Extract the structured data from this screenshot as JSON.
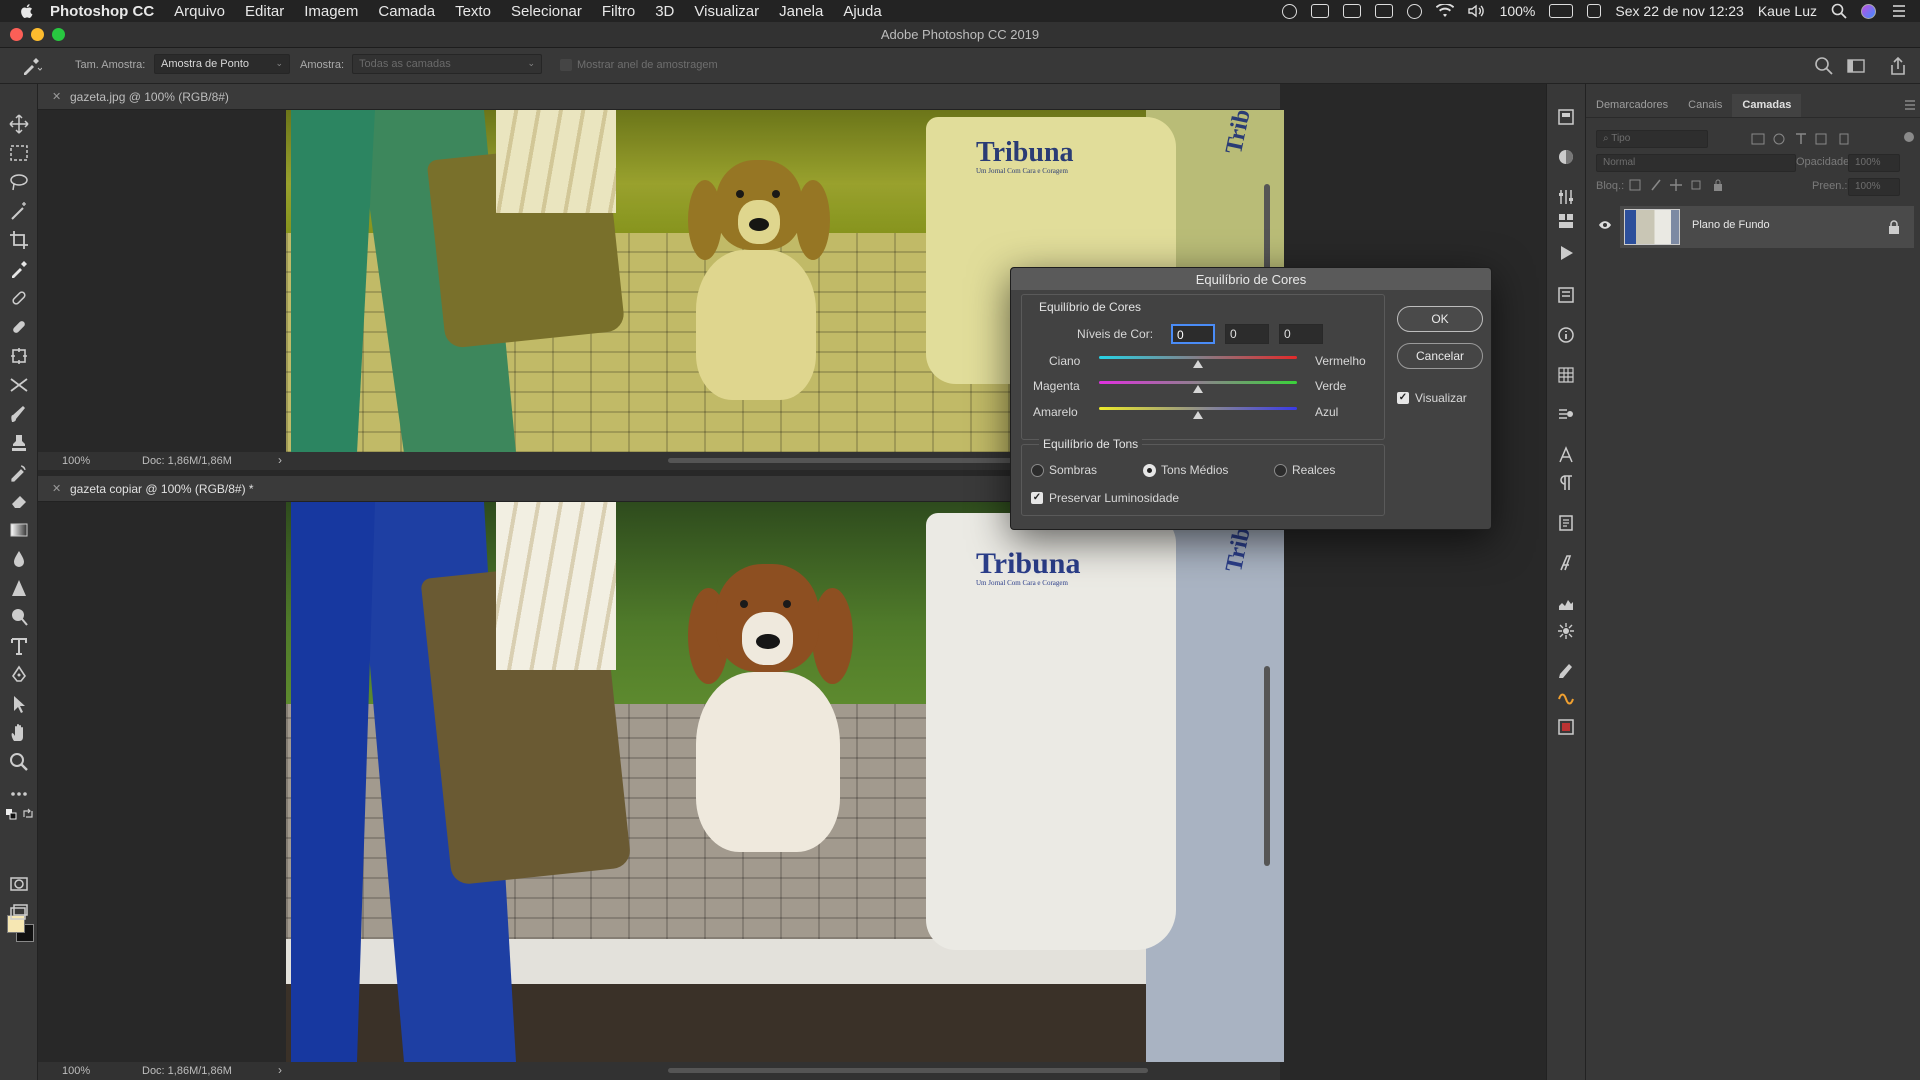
{
  "menubar": {
    "app_name": "Photoshop CC",
    "items": [
      "Arquivo",
      "Editar",
      "Imagem",
      "Camada",
      "Texto",
      "Selecionar",
      "Filtro",
      "3D",
      "Visualizar",
      "Janela",
      "Ajuda"
    ],
    "battery": "100%",
    "datetime": "Sex 22 de nov  12:23",
    "user": "Kaue Luz"
  },
  "window": {
    "title": "Adobe Photoshop CC 2019"
  },
  "options_bar": {
    "sample_size_label": "Tam. Amostra:",
    "sample_size_value": "Amostra de Ponto",
    "sample_label": "Amostra:",
    "sample_value": "Todas as camadas",
    "show_ring_label": "Mostrar anel de amostragem"
  },
  "documents": [
    {
      "tab": "gazeta.jpg @ 100% (RGB/8#)",
      "zoom": "100%",
      "doc_info": "Doc: 1,86M/1,86M"
    },
    {
      "tab": "gazeta copiar @ 100% (RGB/8#) *",
      "zoom": "100%",
      "doc_info": "Doc: 1,86M/1,86M"
    }
  ],
  "photo": {
    "newspaper_name": "Tribuna",
    "newspaper_slogan": "Um Jornal Com Cara e Coragem",
    "side_text": "Tribun"
  },
  "panel": {
    "tabs": [
      "Demarcadores",
      "Canais",
      "Camadas"
    ],
    "active_tab": "Camadas",
    "filter_placeholder": "Tipo",
    "blend_mode": "Normal",
    "opacity_label": "Opacidade:",
    "opacity_value": "100%",
    "lock_label": "Bloq.:",
    "fill_label": "Preen.:",
    "fill_value": "100%",
    "layer_name": "Plano de Fundo"
  },
  "dialog": {
    "title": "Equilíbrio de Cores",
    "group1_title": "Equilíbrio de Cores",
    "levels_label": "Níveis de Cor:",
    "levels": [
      "0",
      "0",
      "0"
    ],
    "sliders": [
      {
        "left": "Ciano",
        "right": "Vermelho",
        "value": 0,
        "min": -100,
        "max": 100
      },
      {
        "left": "Magenta",
        "right": "Verde",
        "value": 0,
        "min": -100,
        "max": 100
      },
      {
        "left": "Amarelo",
        "right": "Azul",
        "value": 0,
        "min": -100,
        "max": 100
      }
    ],
    "group2_title": "Equilíbrio de Tons",
    "tones": [
      "Sombras",
      "Tons Médios",
      "Realces"
    ],
    "selected_tone": "Tons Médios",
    "preserve_label": "Preservar Luminosidade",
    "preserve_checked": true,
    "ok_label": "OK",
    "cancel_label": "Cancelar",
    "preview_label": "Visualizar",
    "preview_checked": true
  }
}
